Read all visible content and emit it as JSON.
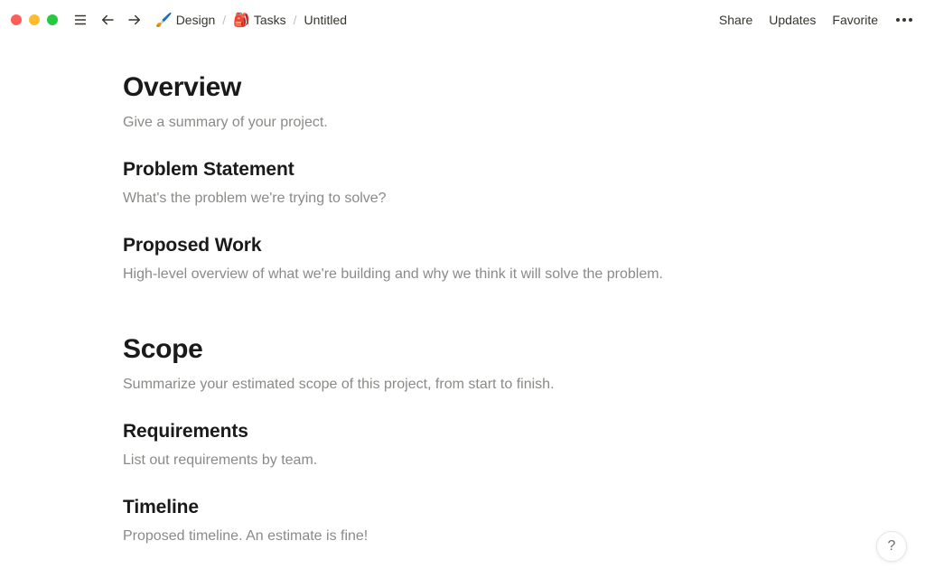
{
  "topbar": {
    "breadcrumb": [
      {
        "icon": "🖌️",
        "label": "Design"
      },
      {
        "icon": "🎒",
        "label": "Tasks"
      },
      {
        "icon": "",
        "label": "Untitled"
      }
    ],
    "actions": {
      "share": "Share",
      "updates": "Updates",
      "favorite": "Favorite"
    }
  },
  "sections": {
    "overview": {
      "heading": "Overview",
      "body": "Give a summary of your project."
    },
    "problem": {
      "heading": "Problem Statement",
      "body": "What's the problem we're trying to solve?"
    },
    "proposed": {
      "heading": "Proposed Work",
      "body": "High-level overview of what we're building and why we think it will solve the problem."
    },
    "scope": {
      "heading": "Scope",
      "body": "Summarize your estimated scope of this project, from start to finish."
    },
    "requirements": {
      "heading": "Requirements",
      "body": "List out requirements by team."
    },
    "timeline": {
      "heading": "Timeline",
      "body": "Proposed timeline. An estimate is fine!"
    }
  },
  "help": "?"
}
